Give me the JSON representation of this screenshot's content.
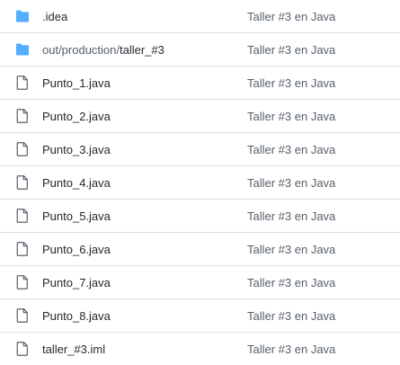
{
  "colors": {
    "folder_icon": "#54aeff",
    "file_icon": "#57606a",
    "text": "#24292f",
    "muted_text": "#57606a",
    "divider": "#d8dee4"
  },
  "rows": [
    {
      "type": "folder",
      "icon": "folder-icon",
      "name": ".idea",
      "commit": "Taller #3 en Java"
    },
    {
      "type": "folder",
      "icon": "folder-icon",
      "name_prefix": "out/production/",
      "name": "taller_#3",
      "commit": "Taller #3 en Java"
    },
    {
      "type": "file",
      "icon": "file-icon",
      "name": "Punto_1.java",
      "commit": "Taller #3 en Java"
    },
    {
      "type": "file",
      "icon": "file-icon",
      "name": "Punto_2.java",
      "commit": "Taller #3 en Java"
    },
    {
      "type": "file",
      "icon": "file-icon",
      "name": "Punto_3.java",
      "commit": "Taller #3 en Java"
    },
    {
      "type": "file",
      "icon": "file-icon",
      "name": "Punto_4.java",
      "commit": "Taller #3 en Java"
    },
    {
      "type": "file",
      "icon": "file-icon",
      "name": "Punto_5.java",
      "commit": "Taller #3 en Java"
    },
    {
      "type": "file",
      "icon": "file-icon",
      "name": "Punto_6.java",
      "commit": "Taller #3 en Java"
    },
    {
      "type": "file",
      "icon": "file-icon",
      "name": "Punto_7.java",
      "commit": "Taller #3 en Java"
    },
    {
      "type": "file",
      "icon": "file-icon",
      "name": "Punto_8.java",
      "commit": "Taller #3 en Java"
    },
    {
      "type": "file",
      "icon": "file-icon",
      "name": "taller_#3.iml",
      "commit": "Taller #3 en Java"
    }
  ]
}
